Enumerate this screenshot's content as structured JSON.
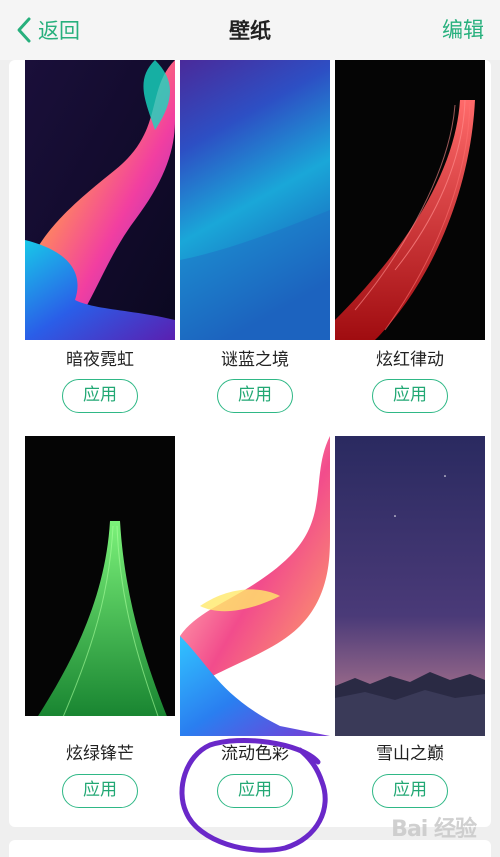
{
  "header": {
    "back_label": "返回",
    "title": "壁纸",
    "edit_label": "编辑"
  },
  "wallpapers": [
    {
      "name": "暗夜霓虹",
      "action": "应用"
    },
    {
      "name": "谜蓝之境",
      "action": "应用"
    },
    {
      "name": "炫红律动",
      "action": "应用"
    },
    {
      "name": "炫绿锋芒",
      "action": "应用"
    },
    {
      "name": "流动色彩",
      "action": "应用"
    },
    {
      "name": "雪山之巅",
      "action": "应用"
    }
  ],
  "watermark": "Bai 经验",
  "colors": {
    "accent": "#27b07d",
    "annotation": "#6a28c9"
  }
}
